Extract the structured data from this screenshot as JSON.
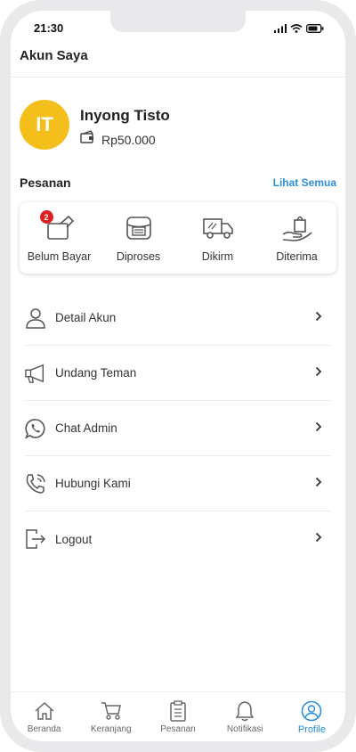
{
  "status_bar": {
    "time": "21:30"
  },
  "header": {
    "title": "Akun Saya"
  },
  "profile": {
    "initials": "IT",
    "name": "Inyong Tisto",
    "balance": "Rp50.000"
  },
  "orders": {
    "title": "Pesanan",
    "see_all_label": "Lihat Semua",
    "items": [
      {
        "label": "Belum Bayar",
        "icon": "wallet-icon",
        "badge": "2"
      },
      {
        "label": "Diproses",
        "icon": "box-icon"
      },
      {
        "label": "Dikirm",
        "icon": "truck-icon"
      },
      {
        "label": "Diterima",
        "icon": "hand-bag-icon"
      }
    ]
  },
  "menu": {
    "items": [
      {
        "label": "Detail Akun",
        "icon": "user-icon"
      },
      {
        "label": "Undang Teman",
        "icon": "megaphone-icon"
      },
      {
        "label": "Chat Admin",
        "icon": "whatsapp-icon"
      },
      {
        "label": "Hubungi Kami",
        "icon": "phone-icon"
      },
      {
        "label": "Logout",
        "icon": "logout-icon"
      }
    ]
  },
  "bottom_nav": {
    "items": [
      {
        "label": "Beranda",
        "icon": "home-icon"
      },
      {
        "label": "Keranjang",
        "icon": "cart-icon"
      },
      {
        "label": "Pesanan",
        "icon": "clipboard-icon"
      },
      {
        "label": "Notifikasi",
        "icon": "bell-icon"
      },
      {
        "label": "Profile",
        "icon": "profile-icon"
      }
    ],
    "active": "Profile"
  },
  "colors": {
    "accent": "#2a8fd6",
    "avatar_bg": "#f5bf1b",
    "badge_bg": "#e0201f",
    "frame": "#e9e9ec"
  }
}
